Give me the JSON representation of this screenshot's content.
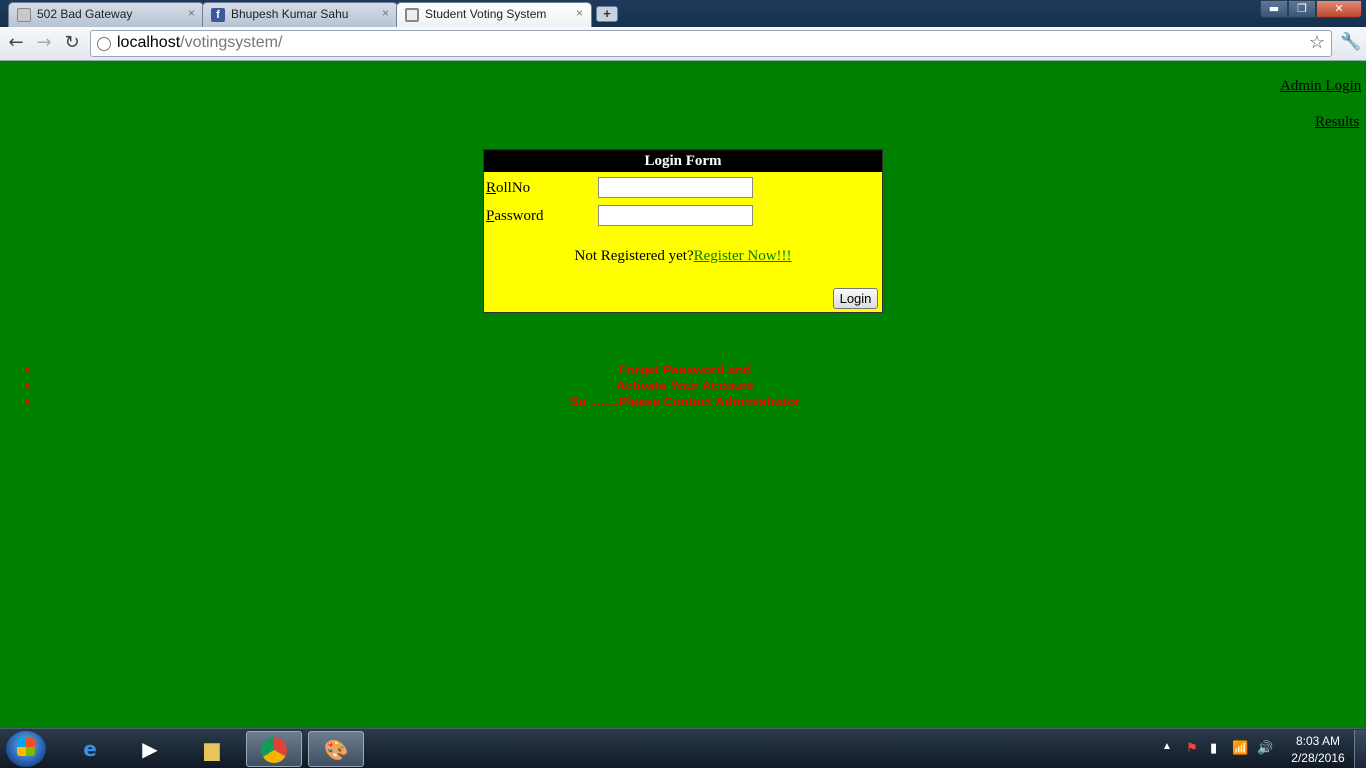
{
  "browser": {
    "tabs": [
      {
        "label": "502 Bad Gateway",
        "close": "×"
      },
      {
        "label": "Bhupesh Kumar Sahu",
        "close": "×"
      },
      {
        "label": "Student Voting System",
        "close": "×"
      }
    ],
    "new_tab": "+",
    "window_buttons": {
      "minimize": "▬",
      "maximize": "❐",
      "close": "✕"
    },
    "nav": {
      "back": "←",
      "forward": "→",
      "reload": "↻"
    },
    "url_host": "localhost",
    "url_path": "/votingsystem/",
    "star": "☆",
    "wrench": "🔧"
  },
  "page": {
    "admin_login": "Admin Login",
    "results": "Results",
    "login_form": {
      "title": "Login Form",
      "rollno_label_access": "R",
      "rollno_label_rest": "ollNo",
      "rollno_value": "",
      "password_label_access": "P",
      "password_label_rest": "assword",
      "password_value": "",
      "not_registered": "Not Registered yet?",
      "register_link": "Register Now!!!",
      "login_button": "Login"
    },
    "notices": [
      "Forget Password and",
      "Activate Your Account",
      "So ........Please Contact Administrator"
    ]
  },
  "taskbar": {
    "tray_arrow": "▲",
    "tray_icons": {
      "flag": "⚑",
      "network": "▮",
      "signal": "📶",
      "volume": "🔊"
    },
    "time": "8:03 AM",
    "date": "2/28/2016"
  },
  "colors": {
    "page_background": "#008000",
    "form_background": "#ffff00",
    "form_header": "#000000",
    "notice_text": "#ff0000",
    "register_link": "#008000"
  }
}
